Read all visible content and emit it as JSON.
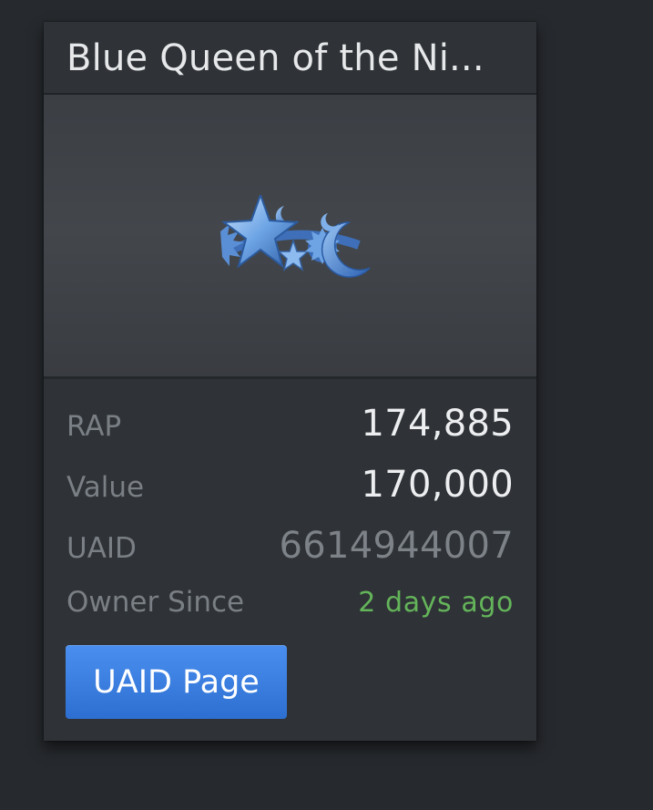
{
  "card": {
    "title": "Blue Queen of the Ni...",
    "image_alt": "Blue Queen of the Night crown",
    "stats": [
      {
        "label": "RAP",
        "value": "174,885"
      },
      {
        "label": "Value",
        "value": "170,000"
      },
      {
        "label": "UAID",
        "value": "6614944007"
      },
      {
        "label": "Owner Since",
        "value": "2 days ago"
      }
    ],
    "button_label": "UAID Page"
  },
  "colors": {
    "background": "#26292d",
    "card": "#2f3337",
    "label": "#7a7f85",
    "value": "#eceef0",
    "muted_value": "#7d8288",
    "owner_since": "#64b45a",
    "button": "#3a7fe0"
  }
}
